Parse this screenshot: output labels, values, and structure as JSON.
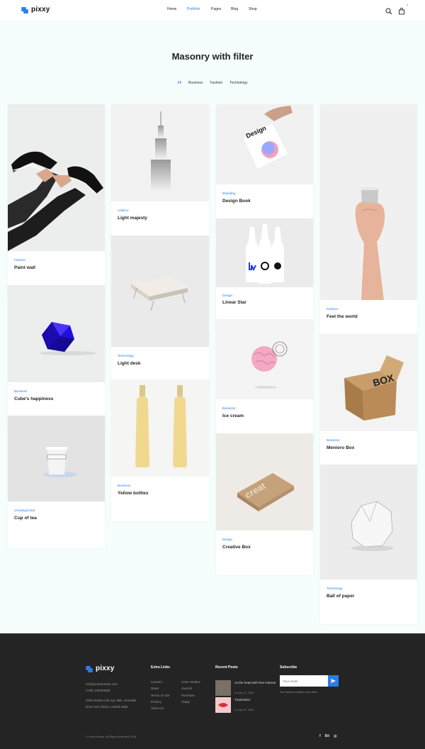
{
  "brand": {
    "name": "pixxy",
    "accent": "#2b7de9"
  },
  "nav": {
    "items": [
      "Home",
      "Portfolio",
      "Pages",
      "Blog",
      "Shop"
    ],
    "active": "Portfolio"
  },
  "header": {
    "cart_count": "0",
    "search_icon": "search-icon",
    "cart_icon": "shopping-bag-icon"
  },
  "page": {
    "title": "Masonry with filter"
  },
  "filters": [
    "All",
    "Business",
    "Fashion",
    "Technology"
  ],
  "cards": [
    {
      "category": "Fashion",
      "title": "Paint wall"
    },
    {
      "category": "Business",
      "title": "Cube's happiness"
    },
    {
      "category": "Uncategorized",
      "title": "Cup of tea"
    },
    {
      "category": "Artdeco",
      "title": "Light majesty"
    },
    {
      "category": "Technology",
      "title": "Light desk"
    },
    {
      "category": "Business",
      "title": "Yellow bottles"
    },
    {
      "category": "Branding",
      "title": "Design Book"
    },
    {
      "category": "Design",
      "title": "Linear Star"
    },
    {
      "category": "Business",
      "title": "Ice cream"
    },
    {
      "category": "Design",
      "title": "Creative Box"
    },
    {
      "category": "Fashion",
      "title": "Feel the world"
    },
    {
      "category": "Business",
      "title": "Menioro Box"
    },
    {
      "category": "Technology",
      "title": "Ball of paper"
    }
  ],
  "footer": {
    "contact": {
      "email": "info@yourdomain.com",
      "phone": "(+88) 129034509",
      "address_line1": "2005 Stokes Isle Apt. 896, Venaville",
      "address_line2": "New York 10010, United State"
    },
    "extra_links": {
      "heading": "Extra Links",
      "col1": [
        "Careers",
        "News",
        "Terms of Use",
        "Privacy",
        "About Us"
      ],
      "col2": [
        "Case Studies",
        "Journal",
        "Purchase",
        "Today"
      ]
    },
    "recent_posts": {
      "heading": "Recent Posts",
      "items": [
        {
          "title": "on the head with free internet",
          "date": "July 23, 2018"
        },
        {
          "title": "Turpisdolor",
          "date": "July 23, 2018"
        }
      ]
    },
    "subscribe": {
      "heading": "Subscribe",
      "placeholder": "Your email",
      "note": "Get lastest updates and offers."
    },
    "copyright": "© Pixxy Studio, All Right Reserved 2018",
    "socials": [
      "f",
      "Bē",
      "◎"
    ]
  }
}
